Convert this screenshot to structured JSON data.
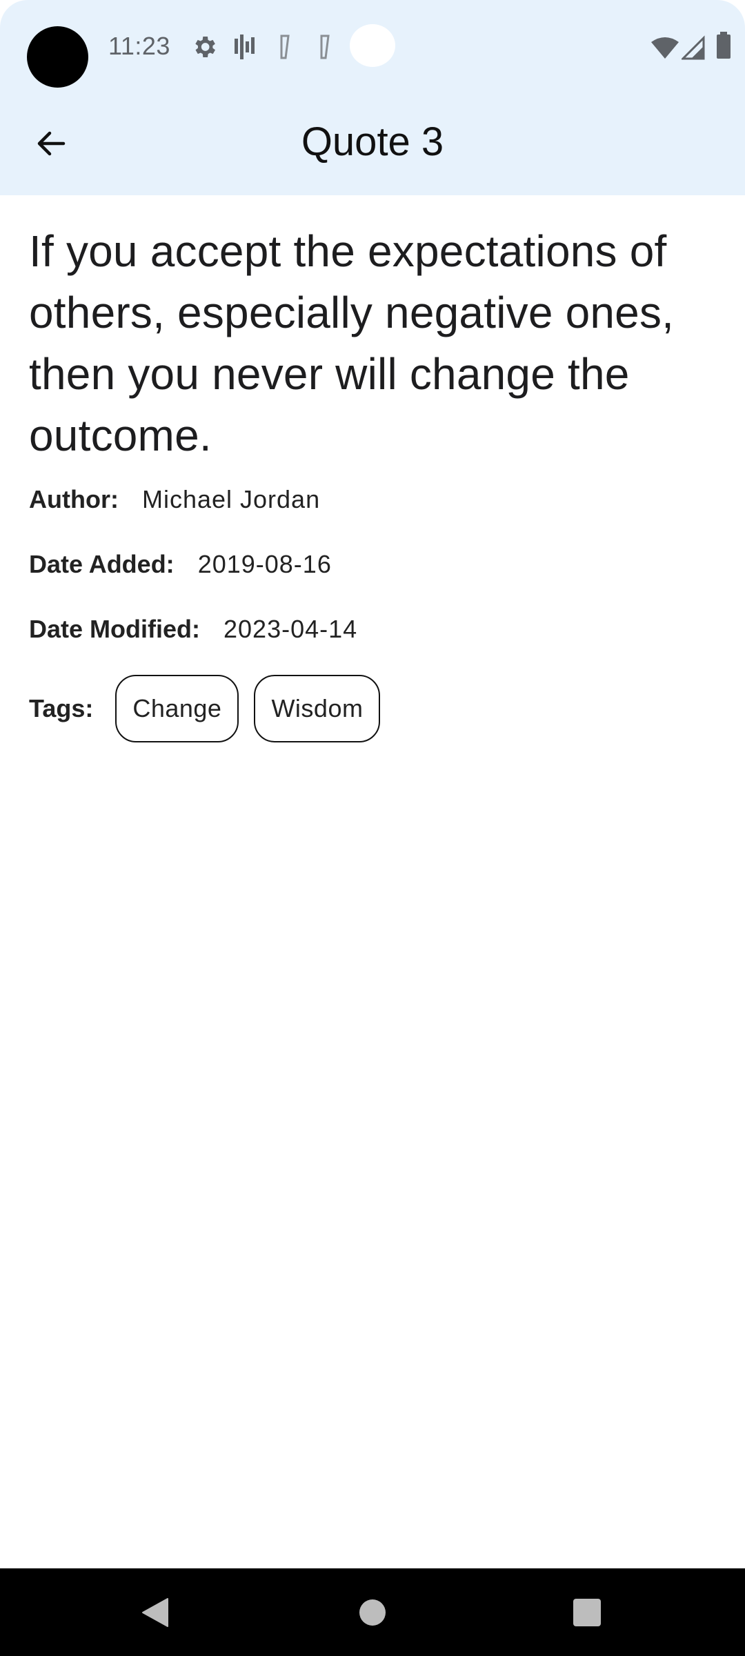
{
  "status_bar": {
    "time": "11:23",
    "icons": [
      "settings-icon",
      "activity-icon",
      "signal-glyph-icon",
      "signal-glyph-icon",
      "wifi-icon",
      "cell-signal-icon",
      "battery-icon"
    ]
  },
  "app_bar": {
    "title": "Quote 3",
    "back_icon": "arrow-left-icon"
  },
  "quote": {
    "text": "If you accept the expectations of others, especially negative ones, then you never will change the outcome.",
    "author_label": "Author:",
    "author": "Michael Jordan",
    "date_added_label": "Date Added:",
    "date_added": "2019-08-16",
    "date_modified_label": "Date Modified:",
    "date_modified": "2023-04-14",
    "tags_label": "Tags:",
    "tags": [
      "Change",
      "Wisdom"
    ]
  },
  "nav_bar": {
    "back": "nav-back-icon",
    "home": "nav-home-icon",
    "recents": "nav-recents-icon"
  },
  "colors": {
    "app_bar_bg": "#e7f2fc",
    "text": "#1d1d1f",
    "nav_bg": "#000000"
  }
}
